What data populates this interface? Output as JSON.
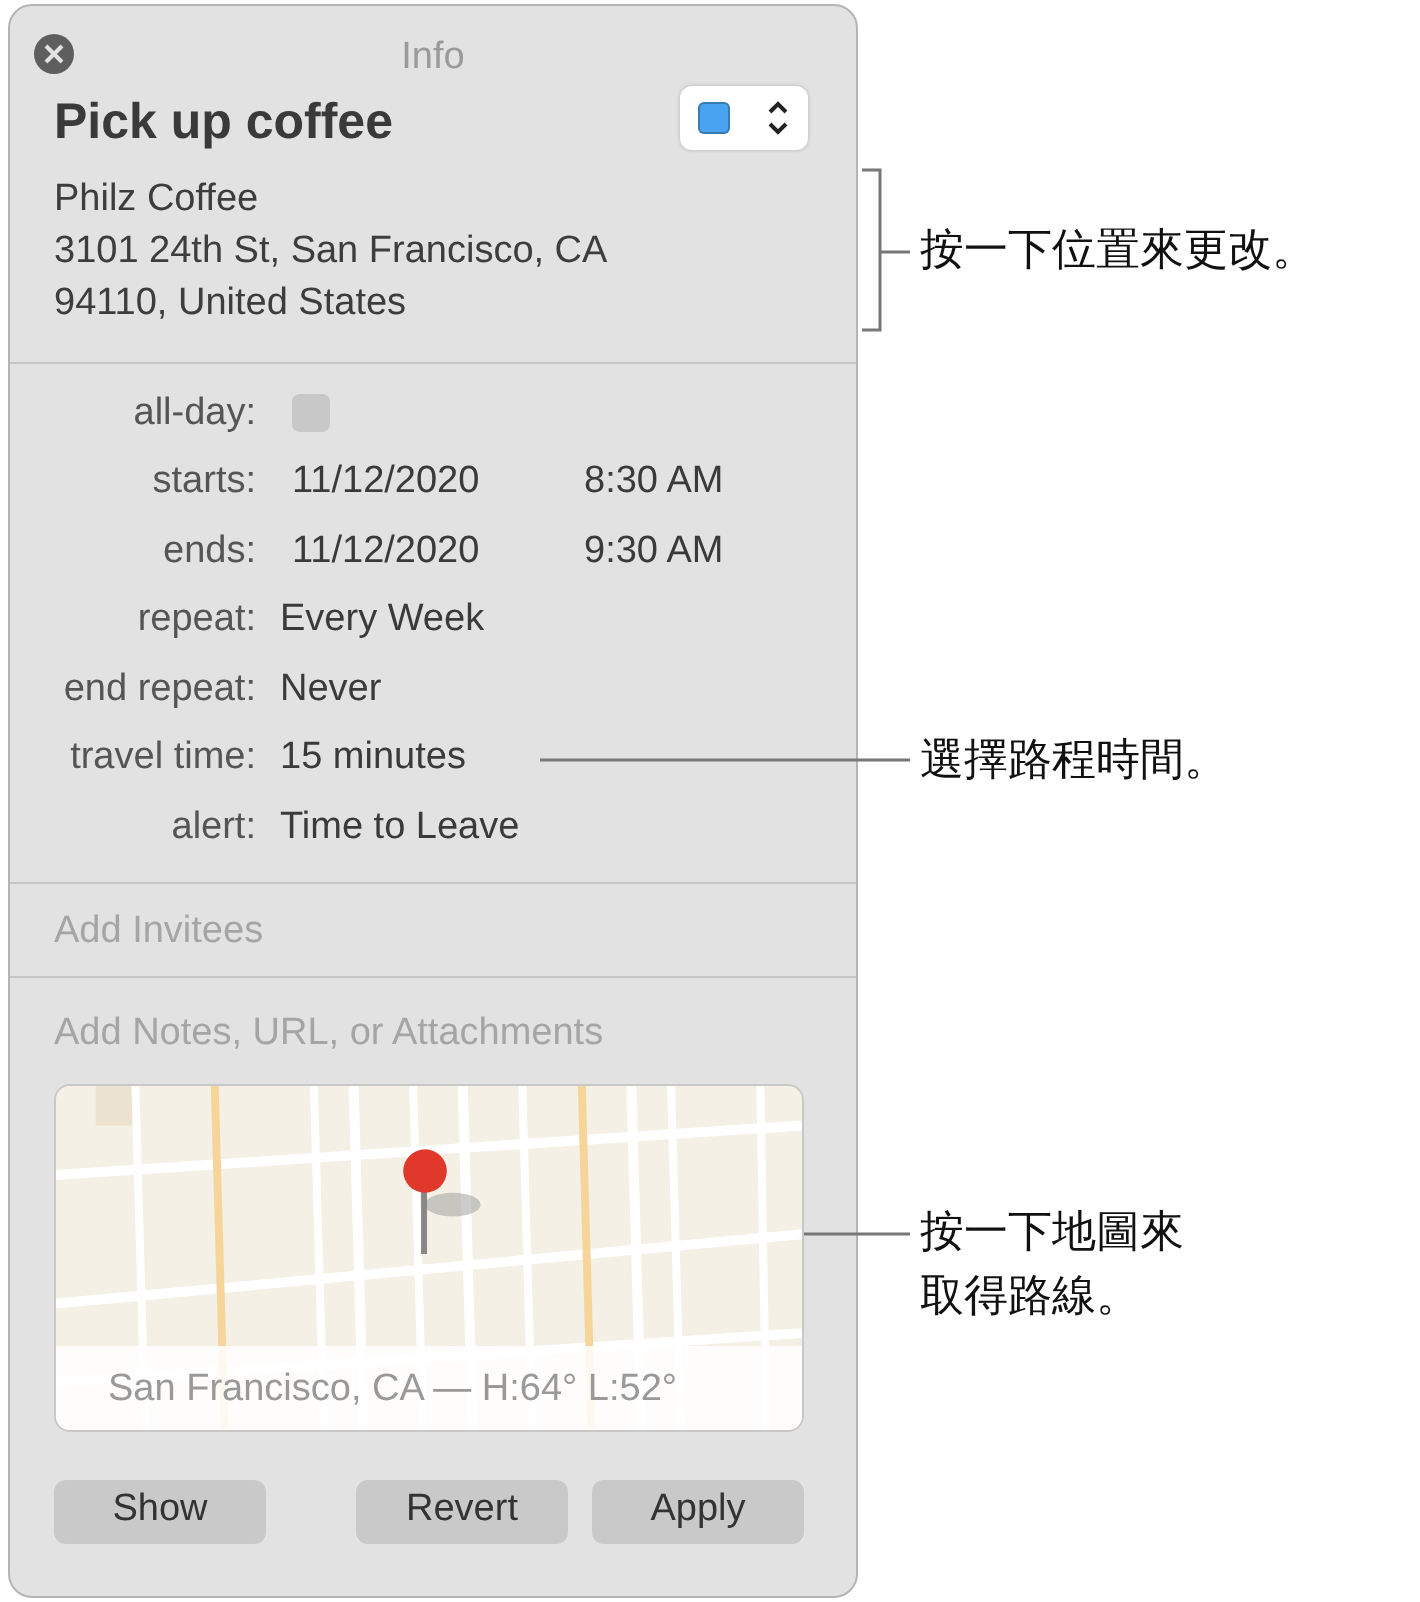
{
  "window": {
    "title": "Info"
  },
  "event": {
    "title": "Pick up coffee",
    "color": "#4aa3f0",
    "location": [
      "Philz Coffee",
      "3101 24th St, San Francisco, CA",
      "94110, United States"
    ]
  },
  "fields": [
    {
      "kind": "checkbox",
      "label": "all-day:",
      "checked": false
    },
    {
      "kind": "datetime",
      "label": "starts:",
      "date": "11/12/2020",
      "time": "8:30 AM"
    },
    {
      "kind": "datetime",
      "label": "ends:",
      "date": "11/12/2020",
      "time": "9:30 AM"
    },
    {
      "kind": "text",
      "label": "repeat:",
      "value": "Every Week"
    },
    {
      "kind": "text",
      "label": "end repeat:",
      "value": "Never"
    },
    {
      "kind": "text",
      "label": "travel time:",
      "value": "15 minutes"
    },
    {
      "kind": "text",
      "label": "alert:",
      "value": "Time to Leave"
    }
  ],
  "invitees": {
    "placeholder": "Add Invitees"
  },
  "notes": {
    "placeholder": "Add Notes, URL, or Attachments"
  },
  "map": {
    "caption": "San Francisco, CA — H:64° L:52°"
  },
  "buttons": [
    "Show",
    "Revert",
    "Apply"
  ],
  "callouts": [
    {
      "lines": [
        "按一下位置來更改。"
      ]
    },
    {
      "lines": [
        "選擇路程時間。"
      ]
    },
    {
      "lines": [
        "按一下地圖來",
        "取得路線。"
      ]
    }
  ]
}
